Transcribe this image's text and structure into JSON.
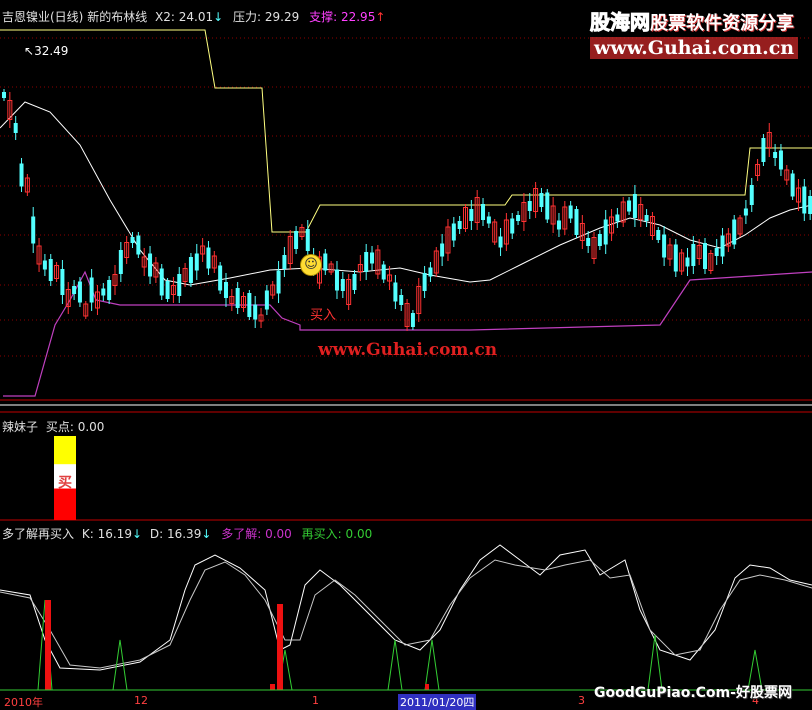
{
  "main_panel": {
    "stock_name": "吉恩镍业(日线)",
    "indicator": "新的布林线",
    "x2_label": "X2:",
    "x2_value": "24.01",
    "resistance_label": "压力:",
    "resistance_value": "29.29",
    "support_label": "支撑:",
    "support_value": "22.95",
    "peak_price": "32.49",
    "buy_marker": "买入",
    "watermark_center": "www.Guhai.com.cn"
  },
  "brand_watermark": {
    "line1_a": "股海网",
    "line1_b": "股票软件资源分享",
    "line2": "www.Guhai.com.cn"
  },
  "sub_panel_1": {
    "title": "辣妹子",
    "buy_point_label": "买点:",
    "buy_point_value": "0.00",
    "bar_text": "买"
  },
  "sub_panel_2": {
    "title": "多了解再买入",
    "k_label": "K:",
    "k_value": "16.19",
    "d_label": "D:",
    "d_value": "16.39",
    "know_more_label": "多了解:",
    "know_more_value": "0.00",
    "buy_again_label": "再买入:",
    "buy_again_value": "0.00"
  },
  "time_axis": {
    "labels": [
      "2010年",
      "12",
      "1",
      "2011/01/20四",
      "3",
      "4"
    ]
  },
  "footer_watermark": "GoodGuPiao.Com-好股票网",
  "colors": {
    "up": "#ff3232",
    "down": "#54ffff",
    "mid_line": "#ffffff",
    "upper_band": "#ffff80",
    "lower_band": "#c040c0",
    "buy_again": "#33cc33",
    "know_more": "#cc33cc",
    "grid": "#8b0000"
  }
}
